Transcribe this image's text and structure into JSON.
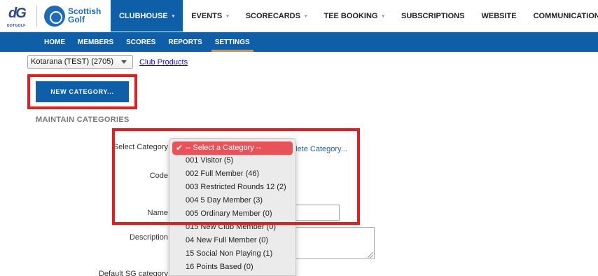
{
  "branding": {
    "dotgolf_label": "DOTGOLF",
    "dotgolf_mark": "dG",
    "scottish_golf_label": "Scottish Golf"
  },
  "top_nav": [
    {
      "label": "CLUBHOUSE",
      "has_caret": true,
      "active": true
    },
    {
      "label": "EVENTS",
      "has_caret": true,
      "active": false
    },
    {
      "label": "SCORECARDS",
      "has_caret": true,
      "active": false
    },
    {
      "label": "TEE BOOKING",
      "has_caret": true,
      "active": false
    },
    {
      "label": "SUBSCRIPTIONS",
      "has_caret": false,
      "active": false
    },
    {
      "label": "WEBSITE",
      "has_caret": false,
      "active": false
    },
    {
      "label": "COMMUNICATIONS",
      "has_caret": true,
      "active": false
    }
  ],
  "sub_nav": [
    {
      "label": "HOME",
      "active": false
    },
    {
      "label": "MEMBERS",
      "active": false
    },
    {
      "label": "SCORES",
      "active": false
    },
    {
      "label": "REPORTS",
      "active": false
    },
    {
      "label": "SETTINGS",
      "active": true
    }
  ],
  "club": {
    "selected": "Kotarana (TEST) (2705)",
    "products_link": "Club Products"
  },
  "new_category_button": "NEW CATEGORY...",
  "section_title": "MAINTAIN CATEGORIES",
  "form": {
    "select_category_label": "Select Category",
    "delete_link": "elete Category...",
    "code_label": "Code",
    "name_label": "Name",
    "description_label": "Description",
    "default_sg_label": "Default SG category"
  },
  "dropdown_options": [
    "-- Select a Category --",
    "001 Visitor (5)",
    "002 Full Member (46)",
    "003 Restricted Rounds 12 (2)",
    "004 5 Day Member (3)",
    "005 Ordinary Member (0)",
    "015 New Club Member (0)",
    "04 New Full Member (0)",
    "15 Social Non Playing (1)",
    "16 Points Based (0)"
  ],
  "dropdown_selected_index": 0,
  "colors": {
    "primary_blue": "#0f5fa8",
    "highlight_red": "#e02020",
    "selected_option": "#e8535a",
    "active_tab_underline": "#f08a24"
  },
  "icons": {
    "caret": "chevron-down-icon",
    "check": "checkmark-icon"
  }
}
